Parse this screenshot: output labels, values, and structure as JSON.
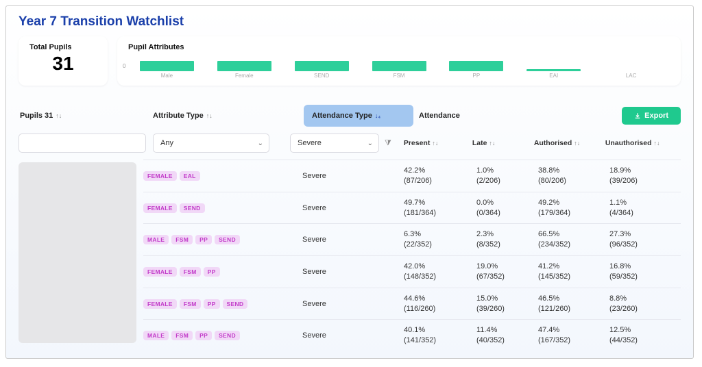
{
  "title": "Year 7 Transition Watchlist",
  "total": {
    "label": "Total Pupils",
    "value": "31"
  },
  "attrs_card": {
    "label": "Pupil Attributes",
    "zero": "0"
  },
  "chart_data": {
    "type": "bar",
    "categories": [
      "Male",
      "Female",
      "SEND",
      "FSM",
      "PP",
      "EAI",
      "LAC"
    ],
    "values": [
      10,
      10,
      10,
      10,
      10,
      2,
      0
    ],
    "ylim": [
      0,
      15
    ],
    "title": "Pupil Attributes",
    "xlabel": "",
    "ylabel": ""
  },
  "headers": {
    "pupils": "Pupils 31",
    "attr_type": "Attribute Type",
    "attend_type": "Attendance Type",
    "attendance": "Attendance",
    "export": "Export",
    "present": "Present",
    "late": "Late",
    "auth": "Authorised",
    "unauth": "Unauthorised"
  },
  "filters": {
    "attr_type": "Any",
    "attend_type": "Severe"
  },
  "rows": [
    {
      "tags": [
        "FEMALE",
        "EAL"
      ],
      "sev": "Severe",
      "present": {
        "pct": "42.2%",
        "frac": "(87/206)"
      },
      "late": {
        "pct": "1.0%",
        "frac": "(2/206)"
      },
      "auth": {
        "pct": "38.8%",
        "frac": "(80/206)"
      },
      "unauth": {
        "pct": "18.9%",
        "frac": "(39/206)"
      }
    },
    {
      "tags": [
        "FEMALE",
        "SEND"
      ],
      "sev": "Severe",
      "present": {
        "pct": "49.7%",
        "frac": "(181/364)"
      },
      "late": {
        "pct": "0.0%",
        "frac": "(0/364)"
      },
      "auth": {
        "pct": "49.2%",
        "frac": "(179/364)"
      },
      "unauth": {
        "pct": "1.1%",
        "frac": "(4/364)"
      }
    },
    {
      "tags": [
        "MALE",
        "FSM",
        "PP",
        "SEND"
      ],
      "sev": "Severe",
      "present": {
        "pct": "6.3%",
        "frac": "(22/352)"
      },
      "late": {
        "pct": "2.3%",
        "frac": "(8/352)"
      },
      "auth": {
        "pct": "66.5%",
        "frac": "(234/352)"
      },
      "unauth": {
        "pct": "27.3%",
        "frac": "(96/352)"
      }
    },
    {
      "tags": [
        "FEMALE",
        "FSM",
        "PP"
      ],
      "sev": "Severe",
      "present": {
        "pct": "42.0%",
        "frac": "(148/352)"
      },
      "late": {
        "pct": "19.0%",
        "frac": "(67/352)"
      },
      "auth": {
        "pct": "41.2%",
        "frac": "(145/352)"
      },
      "unauth": {
        "pct": "16.8%",
        "frac": "(59/352)"
      }
    },
    {
      "tags": [
        "FEMALE",
        "FSM",
        "PP",
        "SEND"
      ],
      "sev": "Severe",
      "present": {
        "pct": "44.6%",
        "frac": "(116/260)"
      },
      "late": {
        "pct": "15.0%",
        "frac": "(39/260)"
      },
      "auth": {
        "pct": "46.5%",
        "frac": "(121/260)"
      },
      "unauth": {
        "pct": "8.8%",
        "frac": "(23/260)"
      }
    },
    {
      "tags": [
        "MALE",
        "FSM",
        "PP",
        "SEND"
      ],
      "sev": "Severe",
      "present": {
        "pct": "40.1%",
        "frac": "(141/352)"
      },
      "late": {
        "pct": "11.4%",
        "frac": "(40/352)"
      },
      "auth": {
        "pct": "47.4%",
        "frac": "(167/352)"
      },
      "unauth": {
        "pct": "12.5%",
        "frac": "(44/352)"
      }
    }
  ]
}
